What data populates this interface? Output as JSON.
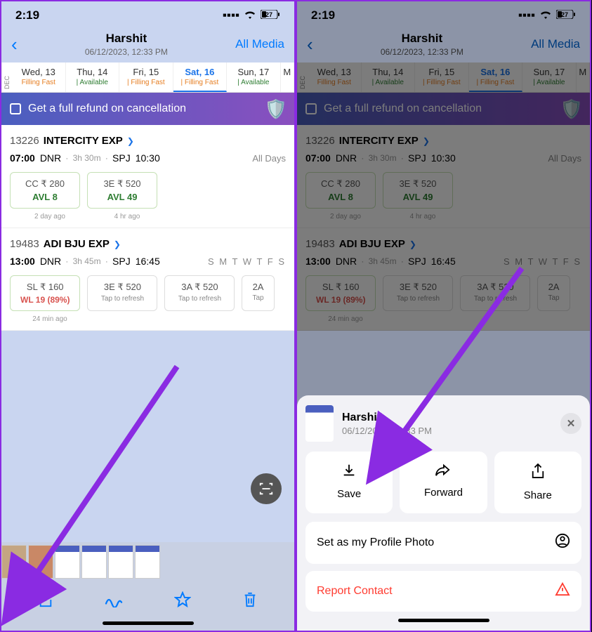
{
  "status": {
    "time": "2:19",
    "battery": "27"
  },
  "nav": {
    "name": "Harshit",
    "sub": "06/12/2023, 12:33 PM",
    "all_media": "All Media"
  },
  "dates": {
    "month": "DEC",
    "items": [
      {
        "d": "Wed, 13",
        "s": "Filling Fast",
        "cls": "filling"
      },
      {
        "d": "Thu, 14",
        "s": "Available",
        "cls": "avail"
      },
      {
        "d": "Fri, 15",
        "s": "Filling Fast",
        "cls": "filling"
      },
      {
        "d": "Sat, 16",
        "s": "Filling Fast",
        "cls": "filling",
        "active": true
      },
      {
        "d": "Sun, 17",
        "s": "Available",
        "cls": "avail"
      }
    ],
    "more": "M"
  },
  "refund": "Get a full refund on cancellation",
  "trains": [
    {
      "num": "13226",
      "name": "INTERCITY EXP",
      "dep": "07:00",
      "from": "DNR",
      "dur": "3h 30m",
      "to": "SPJ",
      "arr": "10:30",
      "days_all": "All Days",
      "fares": [
        {
          "cls": "CC ₹ 280",
          "status": "AVL 8",
          "type": "avl",
          "ago": "2 day ago"
        },
        {
          "cls": "3E ₹ 520",
          "status": "AVL 49",
          "type": "avl",
          "ago": "4 hr ago"
        }
      ]
    },
    {
      "num": "19483",
      "name": "ADI BJU EXP",
      "dep": "13:00",
      "from": "DNR",
      "dur": "3h 45m",
      "to": "SPJ",
      "arr": "16:45",
      "days_letters": "S M T W T F S",
      "fares": [
        {
          "cls": "SL ₹ 160",
          "status": "WL 19 (89%)",
          "type": "wl",
          "ago": "24 min ago"
        },
        {
          "cls": "3E ₹ 520",
          "status": "Tap to refresh",
          "type": "tap"
        },
        {
          "cls": "3A ₹ 520",
          "status": "Tap to refresh",
          "type": "tap"
        },
        {
          "cls": "2A",
          "status": "Tap",
          "type": "tap"
        }
      ]
    }
  ],
  "sheet": {
    "name": "Harshit",
    "date": "06/12/2023, 12:33 PM",
    "actions": [
      {
        "label": "Save"
      },
      {
        "label": "Forward"
      },
      {
        "label": "Share"
      }
    ],
    "profile": "Set as my Profile Photo",
    "report": "Report Contact"
  }
}
